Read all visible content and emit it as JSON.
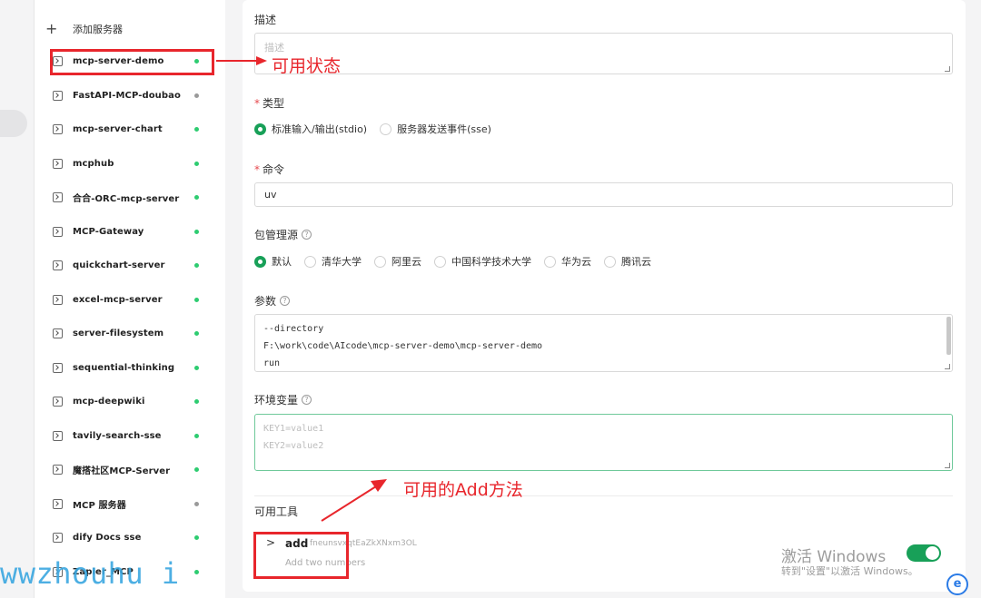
{
  "sidebar": {
    "add_label": "添加服务器",
    "items": [
      {
        "label": "mcp-server-demo",
        "status": "active"
      },
      {
        "label": "FastAPI-MCP-doubao",
        "status": "inactive"
      },
      {
        "label": "mcp-server-chart",
        "status": "active"
      },
      {
        "label": "mcphub",
        "status": "active"
      },
      {
        "label": "合合-ORC-mcp-server",
        "status": "active"
      },
      {
        "label": "MCP-Gateway",
        "status": "active"
      },
      {
        "label": "quickchart-server",
        "status": "active"
      },
      {
        "label": "excel-mcp-server",
        "status": "active"
      },
      {
        "label": "server-filesystem",
        "status": "active"
      },
      {
        "label": "sequential-thinking",
        "status": "active"
      },
      {
        "label": "mcp-deepwiki",
        "status": "active"
      },
      {
        "label": "tavily-search-sse",
        "status": "active"
      },
      {
        "label": "魔搭社区MCP-Server",
        "status": "active"
      },
      {
        "label": "MCP 服务器",
        "status": "inactive"
      },
      {
        "label": "dify Docs sse",
        "status": "active"
      },
      {
        "label": "Zapier_MCP",
        "status": "active"
      }
    ]
  },
  "form": {
    "description": {
      "label": "描述",
      "placeholder": "描述"
    },
    "type": {
      "label": "类型",
      "options": [
        "标准输入/输出(stdio)",
        "服务器发送事件(sse)"
      ],
      "selected": 0
    },
    "command": {
      "label": "命令",
      "value": "uv"
    },
    "package_source": {
      "label": "包管理源",
      "options": [
        "默认",
        "清华大学",
        "阿里云",
        "中国科学技术大学",
        "华为云",
        "腾讯云"
      ],
      "selected": 0
    },
    "args": {
      "label": "参数",
      "lines": [
        "--directory",
        "F:\\work\\code\\AIcode\\mcp-server-demo\\mcp-server-demo",
        "run"
      ]
    },
    "env": {
      "label": "环境变量",
      "placeholder_lines": [
        "KEY1=value1",
        "KEY2=value2"
      ]
    },
    "tools": {
      "label": "可用工具",
      "items": [
        {
          "name": "add",
          "id": "fneunsvxqtEaZkXNxm3OL",
          "description": "Add two numbers"
        }
      ]
    }
  },
  "annotations": {
    "status_note": "可用状态",
    "tool_note": "可用的Add方法"
  },
  "watermark": {
    "title": "激活 Windows",
    "subtitle": "转到\"设置\"以激活 Windows。",
    "site": "wwzhouhu i"
  },
  "colors": {
    "accent_green": "#18a058",
    "status_active": "#2ecc71",
    "status_inactive": "#9a9a9a",
    "annotation_red": "#e8262c"
  }
}
